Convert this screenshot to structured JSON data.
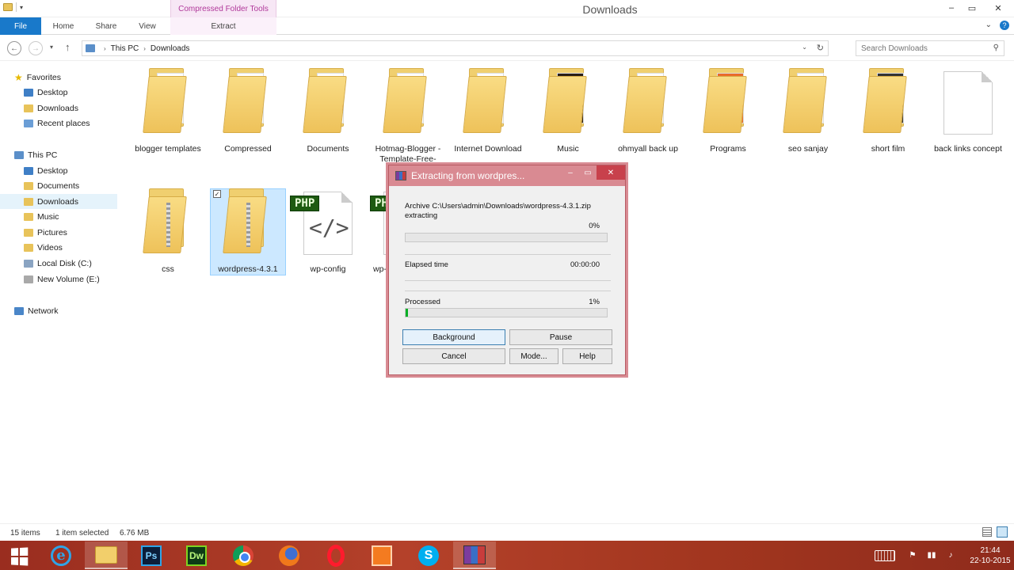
{
  "window": {
    "title": "Downloads",
    "context_tab_header": "Compressed Folder Tools",
    "controls": {
      "minimize": "–",
      "maximize": "▭",
      "close": "✕"
    }
  },
  "ribbon": {
    "tabs": [
      "File",
      "Home",
      "Share",
      "View",
      "Extract"
    ],
    "expand": "⌄",
    "help": "?"
  },
  "address": {
    "back": "←",
    "forward": "→",
    "recent": "▾",
    "up": "↑",
    "crumbs": [
      "This PC",
      "Downloads"
    ],
    "dropdown": "⌄",
    "refresh": "↻",
    "search_placeholder": "Search Downloads",
    "search_icon": "⚲"
  },
  "navpane": {
    "favorites_label": "Favorites",
    "favorites": [
      "Desktop",
      "Downloads",
      "Recent places"
    ],
    "thispc_label": "This PC",
    "thispc": [
      "Desktop",
      "Documents",
      "Downloads",
      "Music",
      "Pictures",
      "Videos",
      "Local Disk (C:)",
      "New Volume (E:)"
    ],
    "network_label": "Network",
    "selected": "Downloads"
  },
  "files": [
    {
      "name": "blogger templates",
      "type": "folder"
    },
    {
      "name": "Compressed",
      "type": "folder"
    },
    {
      "name": "Documents",
      "type": "folder"
    },
    {
      "name": "Hotmag-Blogger -Template-Free-",
      "type": "folder"
    },
    {
      "name": "Internet Download",
      "type": "folder"
    },
    {
      "name": "Music",
      "type": "folder"
    },
    {
      "name": "ohmyall back up",
      "type": "folder"
    },
    {
      "name": "Programs",
      "type": "folder"
    },
    {
      "name": "seo sanjay",
      "type": "folder"
    },
    {
      "name": "short film",
      "type": "folder"
    },
    {
      "name": "back links concept",
      "type": "file"
    },
    {
      "name": "css",
      "type": "zip"
    },
    {
      "name": "wordpress-4.3.1",
      "type": "zip",
      "selected": true
    },
    {
      "name": "wp-config",
      "type": "php"
    },
    {
      "name": "wp-",
      "type": "php"
    }
  ],
  "file_tile": {
    "php_badge": "PHP",
    "code_glyph": "</>",
    "check_mark": "✓"
  },
  "dialog": {
    "title": "Extracting from wordpres...",
    "archive_line": "Archive C:\\Users\\admin\\Downloads\\wordpress-4.3.1.zip",
    "status": "extracting",
    "percent": "0%",
    "progress_fraction": 0.0,
    "elapsed_label": "Elapsed time",
    "elapsed_value": "00:00:00",
    "processed_label": "Processed",
    "processed_percent": "1%",
    "processed_fraction": 0.01,
    "buttons": [
      "Background",
      "Pause",
      "Cancel",
      "Mode...",
      "Help"
    ],
    "controls": {
      "minimize": "–",
      "maximize": "▭",
      "close": "✕"
    }
  },
  "statusbar": {
    "item_count": "15 items",
    "selected": "1 item selected",
    "size": "6.76 MB"
  },
  "taskbar": {
    "apps": [
      "internet-explorer",
      "file-explorer",
      "photoshop",
      "dreamweaver",
      "chrome",
      "firefox",
      "opera",
      "orange-app",
      "skype",
      "winrar"
    ],
    "app_labels": {
      "ie": "e",
      "ps": "Ps",
      "dw": "Dw",
      "skype": "S"
    },
    "tray_icons": {
      "flag": "⚑",
      "network": "▮▮",
      "volume": "♪"
    },
    "time": "21:44",
    "date": "22-10-2015"
  },
  "colors": {
    "accent": "#1979ca",
    "context_tab": "#b0389a",
    "dialog_frame": "#d98a92",
    "taskbar": "#a2361f",
    "progress": "#06b025"
  }
}
